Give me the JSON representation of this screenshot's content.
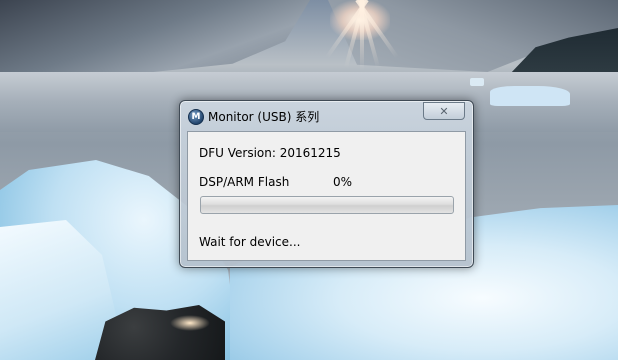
{
  "window": {
    "title": "Monitor (USB) 系列",
    "icon": "monitor-app-icon",
    "close_icon": "close-icon"
  },
  "content": {
    "dfu_version": "DFU Version: 20161215",
    "flash_label": "DSP/ARM Flash",
    "flash_percent": "0%",
    "progress_value": 0,
    "status": "Wait for device..."
  },
  "colors": {
    "progress_fill": "#3fc43a",
    "client_bg": "#f0f0f0"
  }
}
